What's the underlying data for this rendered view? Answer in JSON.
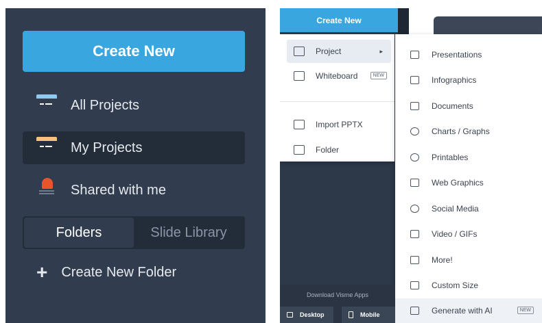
{
  "left_panel": {
    "create_label": "Create New",
    "nav": [
      {
        "label": "All Projects"
      },
      {
        "label": "My Projects"
      },
      {
        "label": "Shared with me"
      }
    ],
    "tabs": [
      "Folders",
      "Slide Library"
    ],
    "create_folder_label": "Create New Folder"
  },
  "right_panel": {
    "create_label": "Create New",
    "menu": [
      {
        "label": "Project",
        "submenu_arrow": "▸"
      },
      {
        "label": "Whiteboard",
        "badge": "NEW"
      },
      {
        "label": "Import PPTX"
      },
      {
        "label": "Folder"
      }
    ],
    "submenu": [
      {
        "label": "Presentations"
      },
      {
        "label": "Infographics"
      },
      {
        "label": "Documents"
      },
      {
        "label": "Charts / Graphs"
      },
      {
        "label": "Printables"
      },
      {
        "label": "Web Graphics"
      },
      {
        "label": "Social Media"
      },
      {
        "label": "Video / GIFs"
      },
      {
        "label": "More!"
      },
      {
        "label": "Custom Size"
      },
      {
        "label": "Generate with AI",
        "badge": "NEW"
      }
    ],
    "download_text": "Download Visme Apps",
    "desktop_label": "Desktop",
    "mobile_label": "Mobile"
  },
  "colors": {
    "accent": "#3aa6e0",
    "panel": "#313d4e"
  }
}
